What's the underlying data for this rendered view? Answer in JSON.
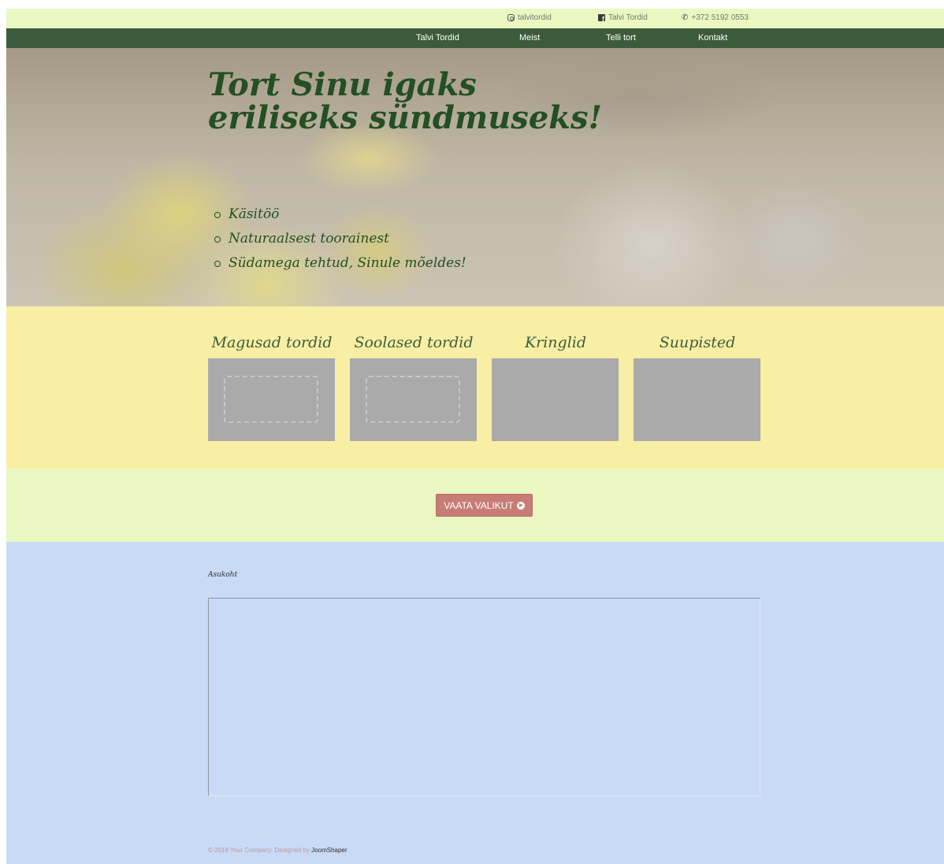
{
  "topbar": {
    "instagram": "talvitordid",
    "facebook": "Talvi Tordid",
    "phone": "+372 5192 0553"
  },
  "nav": {
    "items": [
      "Talvi Tordid",
      "Meist",
      "Telli tort",
      "Kontakt"
    ]
  },
  "hero": {
    "title": "Tort Sinu igaks eriliseks sündmuseks!",
    "bullets": [
      "Käsitöö",
      "Naturaalsest toorainest",
      "Südamega tehtud, Sinule mõeldes!"
    ]
  },
  "products": [
    {
      "title": "Magusad tordid"
    },
    {
      "title": "Soolased tordid"
    },
    {
      "title": "Kringlid"
    },
    {
      "title": "Suupisted"
    }
  ],
  "cta": {
    "label": "VAATA VALIKUT"
  },
  "contact": {
    "label": "Asukoht"
  },
  "footer": {
    "text": "© 2018 Your Company. Designed by ",
    "link": "JoomShaper"
  },
  "colors": {
    "topbar_bg": "#eaf7c0",
    "nav_bg": "#3c5b3c",
    "hero_text": "#234f23",
    "products_bg": "#f8eea4",
    "cta_bg": "#c77c75",
    "contact_bg": "#c8daf6"
  },
  "icons": {
    "instagram": "instagram-icon",
    "facebook": "facebook-icon",
    "phone": "phone-icon",
    "cta_arrow": "arrow-circle-right-icon"
  }
}
